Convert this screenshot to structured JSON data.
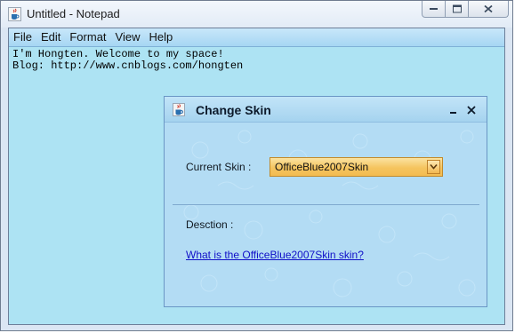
{
  "window": {
    "title": "Untitled - Notepad",
    "icon": "java-cup-icon"
  },
  "menubar": {
    "items": [
      "File",
      "Edit",
      "Format",
      "View",
      "Help"
    ]
  },
  "editor": {
    "lines": [
      "I'm Hongten. Welcome to my space!",
      "Blog: http://www.cnblogs.com/hongten"
    ]
  },
  "dialog": {
    "title": "Change Skin",
    "icon": "java-cup-icon",
    "current_skin_label": "Current Skin :",
    "current_skin_value": "OfficeBlue2007Skin",
    "description_label": "Desction :",
    "link_text": "What is the OfficeBlue2007Skin skin?"
  },
  "colors": {
    "client_bg": "#ade3f3",
    "dialog_bg": "#b3dcf4",
    "combo_bg": "#f5c45f",
    "link": "#1010c8"
  }
}
